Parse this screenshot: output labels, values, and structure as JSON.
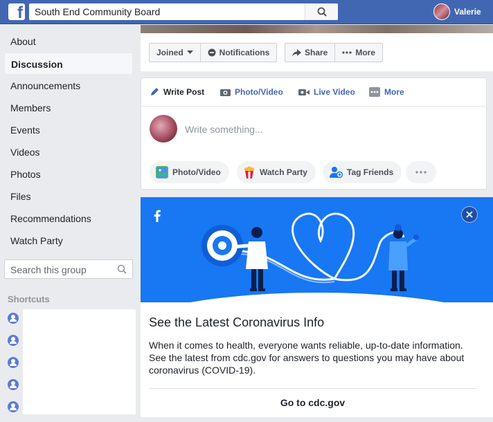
{
  "topbar": {
    "search_value": "South End Community Board",
    "user_name": "Valerie"
  },
  "nav": {
    "items": [
      "About",
      "Discussion",
      "Announcements",
      "Members",
      "Events",
      "Videos",
      "Photos",
      "Files",
      "Recommendations",
      "Watch Party"
    ],
    "active": "Discussion",
    "search_placeholder": "Search this group",
    "shortcuts_title": "Shortcuts"
  },
  "actions": {
    "joined": "Joined",
    "notifications": "Notifications",
    "share": "Share",
    "more": "More"
  },
  "composer": {
    "tabs": [
      "Write Post",
      "Photo/Video",
      "Live Video",
      "More"
    ],
    "placeholder": "Write something...",
    "pills": [
      "Photo/Video",
      "Watch Party",
      "Tag Friends"
    ]
  },
  "covid": {
    "title": "See the Latest Coronavirus Info",
    "body": "When it comes to health, everyone wants reliable, up-to-date information. See the latest from cdc.gov for answers to questions you may have about coronavirus (COVID-19).",
    "link": "Go to cdc.gov"
  },
  "colors": {
    "brand": "#4267b2",
    "hero": "#1877f2",
    "page_bg": "#e9ebee"
  }
}
